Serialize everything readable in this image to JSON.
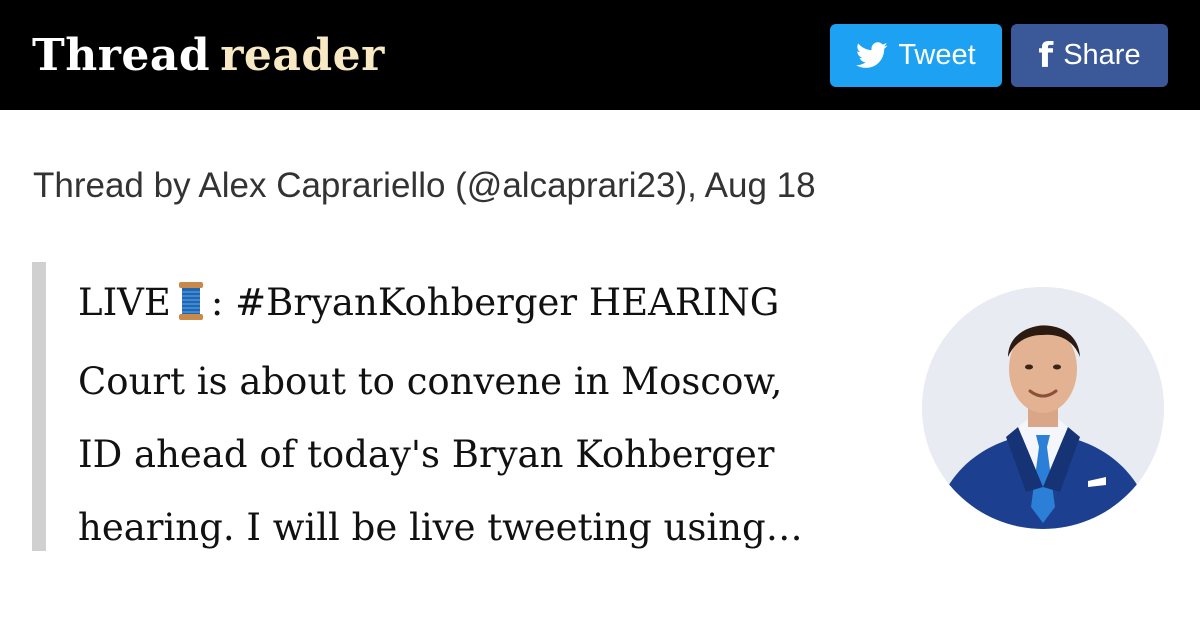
{
  "header": {
    "logo_primary": "Thread",
    "logo_secondary": "reader",
    "tweet_button_label": "Tweet",
    "share_button_label": "Share",
    "colors": {
      "bar": "#000000",
      "tweet": "#1da1f2",
      "share": "#3b5998",
      "logo_accent": "#f7e9c4"
    }
  },
  "thread": {
    "byline": "Thread by Alex Caprariello (@alcaprari23), Aug 18",
    "text_lines": [
      {
        "before_icon": "LIVE",
        "after_icon": ": #BryanKohberger HEARING"
      },
      "Court is about to convene in Moscow,",
      "ID ahead of today's Bryan Kohberger",
      "hearing. I will be live tweeting using…"
    ],
    "inline_icon": "thread-spool-icon"
  },
  "author": {
    "avatar_icon": "author-avatar"
  }
}
